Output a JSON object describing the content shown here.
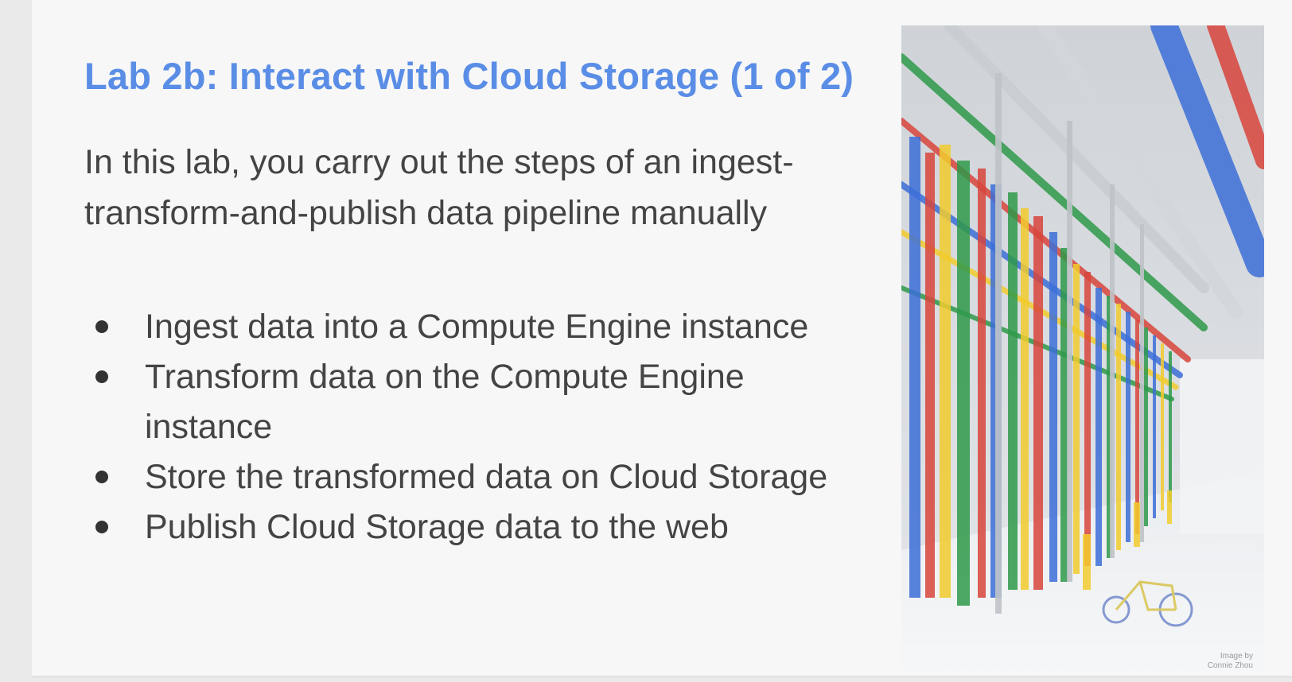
{
  "slide": {
    "title": "Lab 2b: Interact with Cloud Storage (1 of 2)",
    "intro": "In this lab, you carry out the steps of an ingest-transform-and-publish data pipeline manually",
    "bullets": [
      "Ingest data into a Compute Engine instance",
      "Transform data on the Compute Engine instance",
      "Store the transformed data on Cloud Storage",
      "Publish Cloud Storage data to the web"
    ],
    "image_credit": "Image by\nConnie Zhou"
  },
  "colors": {
    "title": "#5a8de6",
    "body_text": "#444444",
    "pipe_blue": "#3d6fd8",
    "pipe_red": "#d8453c",
    "pipe_green": "#2f9a4a",
    "pipe_yellow": "#f2cc2e"
  }
}
